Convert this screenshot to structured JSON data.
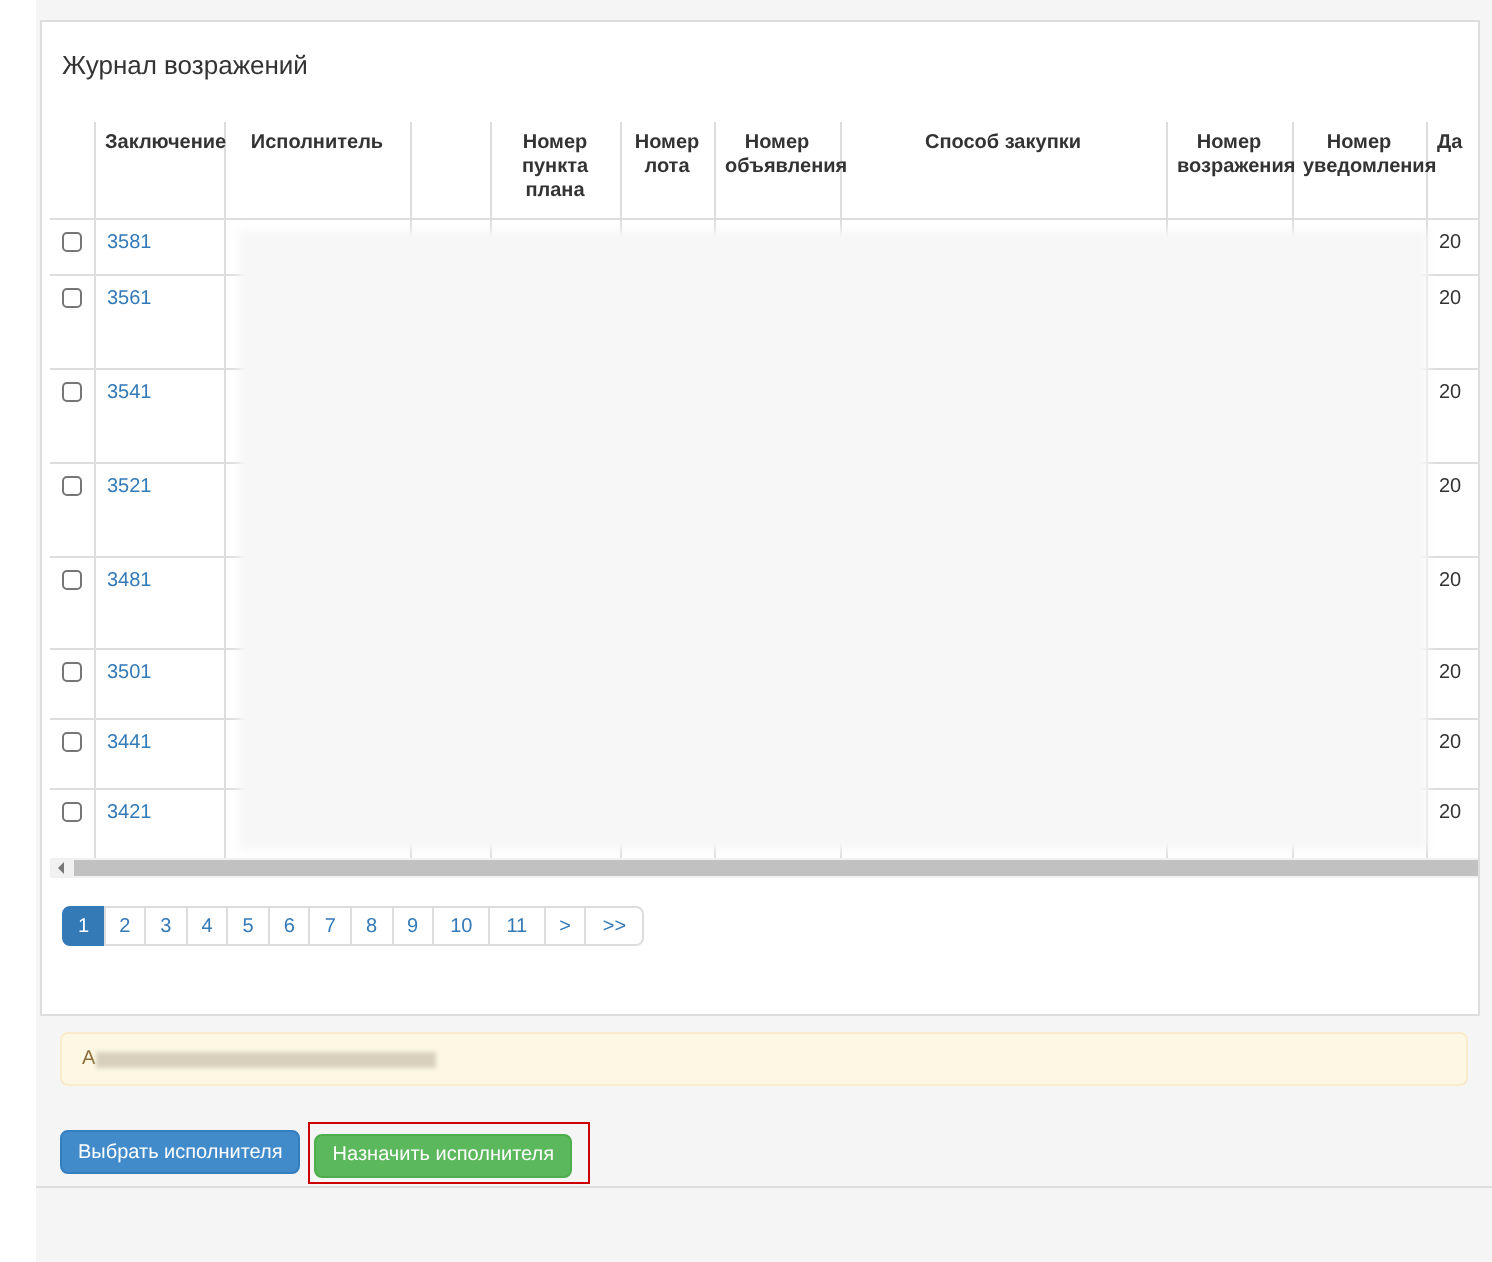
{
  "panel": {
    "title": "Журнал возражений"
  },
  "table": {
    "columns": [
      "Заключение",
      "Исполнитель",
      "",
      "Номер пункта плана",
      "Номер лота",
      "Номер объявления",
      "Способ закупки",
      "Номер возражения",
      "Номер уведомления",
      "Да"
    ],
    "rows": [
      {
        "checked": false,
        "conclusion": "3581",
        "column_10": "20"
      },
      {
        "checked": false,
        "conclusion": "3561",
        "column_10": "20"
      },
      {
        "checked": false,
        "conclusion": "3541",
        "column_10": "20"
      },
      {
        "checked": false,
        "conclusion": "3521",
        "column_10": "20"
      },
      {
        "checked": false,
        "conclusion": "3481",
        "column_10": "20"
      },
      {
        "checked": false,
        "conclusion": "3501",
        "column_10": "20"
      },
      {
        "checked": false,
        "conclusion": "3441",
        "column_10": "20"
      },
      {
        "checked": false,
        "conclusion": "3421",
        "column_10": "20"
      }
    ]
  },
  "pagination": [
    {
      "label": "1",
      "selected": true
    },
    {
      "label": "2",
      "selected": false
    },
    {
      "label": "3",
      "selected": false
    },
    {
      "label": "4",
      "selected": false
    },
    {
      "label": "5",
      "selected": false
    },
    {
      "label": "6",
      "selected": false
    },
    {
      "label": "7",
      "selected": false
    },
    {
      "label": "8",
      "selected": false
    },
    {
      "label": "9",
      "selected": false
    },
    {
      "label": "10",
      "selected": false
    },
    {
      "label": "11",
      "selected": false
    },
    {
      "label": ">",
      "selected": false
    },
    {
      "label": ">>",
      "selected": false
    }
  ],
  "alert": {
    "text": "А"
  },
  "buttons": [
    {
      "label": "Выбрать исполнителя",
      "kind": "primary",
      "highlighted": false
    },
    {
      "label": "Назначить исполнителя",
      "kind": "success",
      "highlighted": true
    }
  ]
}
